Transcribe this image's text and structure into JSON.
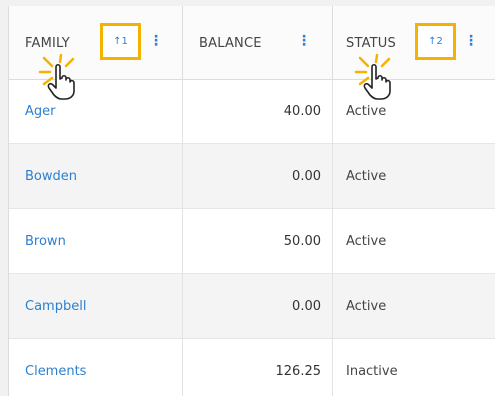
{
  "columns": {
    "family": {
      "label": "FAMILY",
      "sort_indicator": "↑1"
    },
    "balance": {
      "label": "BALANCE"
    },
    "status": {
      "label": "STATUS",
      "sort_indicator": "↑2"
    }
  },
  "menu_glyph": "⋮",
  "rows": [
    {
      "family": "Ager",
      "balance": "40.00",
      "status": "Active"
    },
    {
      "family": "Bowden",
      "balance": "0.00",
      "status": "Active"
    },
    {
      "family": "Brown",
      "balance": "50.00",
      "status": "Active"
    },
    {
      "family": "Campbell",
      "balance": "0.00",
      "status": "Active"
    },
    {
      "family": "Clements",
      "balance": "126.25",
      "status": "Inactive"
    }
  ],
  "colors": {
    "link": "#2d7fcf",
    "highlight": "#f4b300",
    "row_alt": "#f4f4f4",
    "border": "#dcdcdc"
  }
}
